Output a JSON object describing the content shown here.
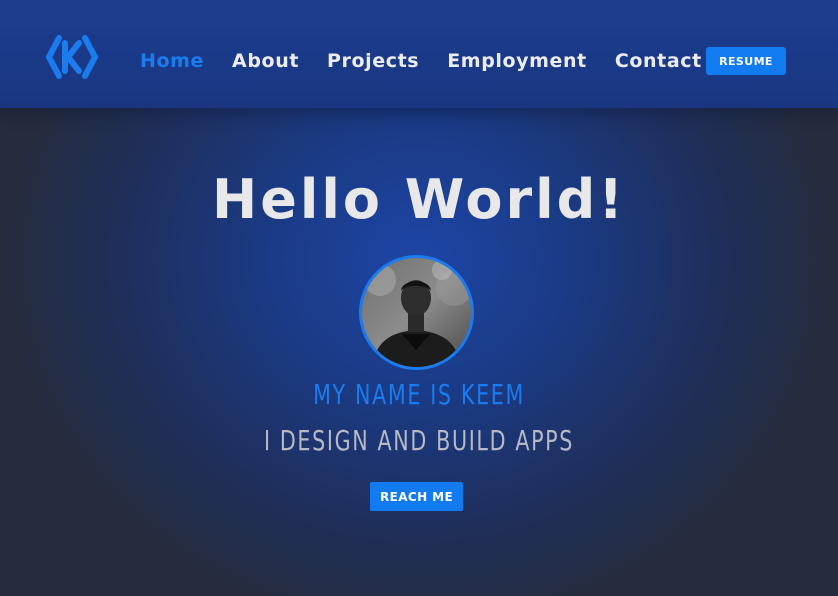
{
  "nav": {
    "logo_icon": "k-brackets-logo-icon",
    "links": [
      {
        "label": "Home",
        "active": true
      },
      {
        "label": "About",
        "active": false
      },
      {
        "label": "Projects",
        "active": false
      },
      {
        "label": "Employment",
        "active": false
      },
      {
        "label": "Contact",
        "active": false
      }
    ],
    "resume_label": "RESUME"
  },
  "hero": {
    "title": "Hello World!",
    "avatar_icon": "profile-photo",
    "name_line": "MY NAME IS KEEM",
    "tagline": "I DESIGN AND BUILD APPS",
    "cta_label": "REACH ME"
  },
  "colors": {
    "accent": "#137bf0",
    "nav_bg": "#1a3a88",
    "page_bg": "#262c3b",
    "title_text": "#e8e8ea",
    "tagline_text": "#b7b9c6"
  }
}
